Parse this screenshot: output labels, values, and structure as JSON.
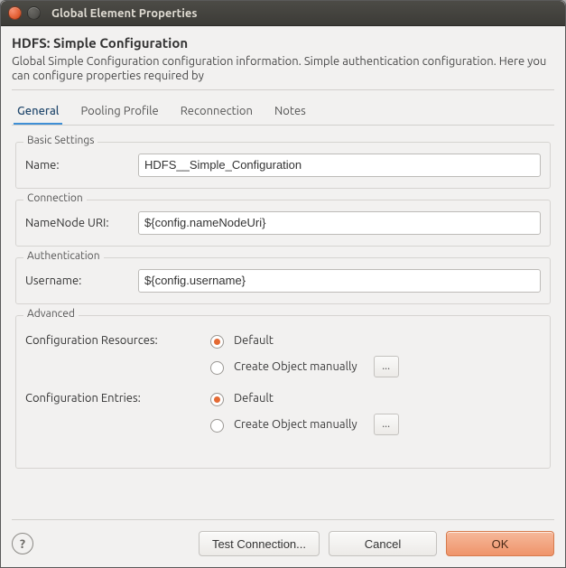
{
  "window": {
    "title": "Global Element Properties"
  },
  "header": {
    "title": "HDFS: Simple Configuration",
    "description": "Global Simple Configuration configuration information. Simple authentication configuration. Here you can configure properties required by"
  },
  "tabs": [
    "General",
    "Pooling Profile",
    "Reconnection",
    "Notes"
  ],
  "groups": {
    "basic": {
      "legend": "Basic Settings",
      "name_label": "Name:",
      "name_value": "HDFS__Simple_Configuration"
    },
    "connection": {
      "legend": "Connection",
      "uri_label": "NameNode URI:",
      "uri_value": "${config.nameNodeUri}"
    },
    "auth": {
      "legend": "Authentication",
      "user_label": "Username:",
      "user_value": "${config.username}"
    },
    "advanced": {
      "legend": "Advanced",
      "resources_label": "Configuration Resources:",
      "entries_label": "Configuration Entries:",
      "option_default": "Default",
      "option_manual": "Create Object manually",
      "browse": "..."
    }
  },
  "buttons": {
    "help": "?",
    "test": "Test Connection...",
    "cancel": "Cancel",
    "ok": "OK"
  }
}
